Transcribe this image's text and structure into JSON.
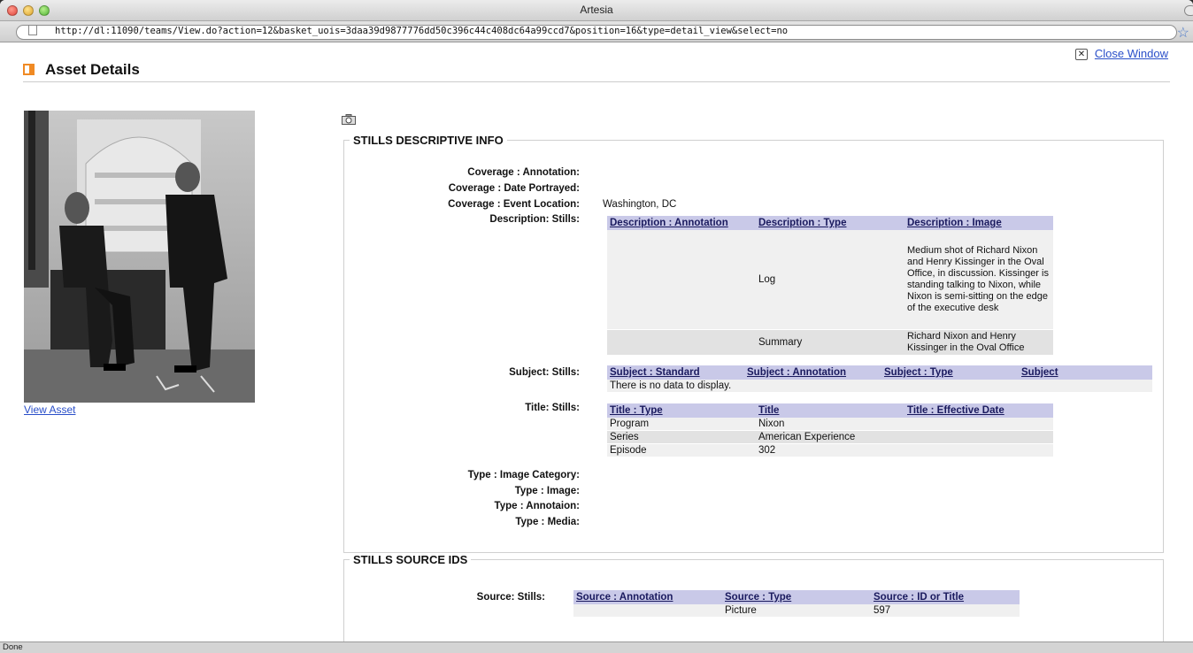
{
  "browser": {
    "window_title": "Artesia",
    "url": "http://dl:11090/teams/View.do?action=12&basket_uois=3daa39d9877776dd50c396c44c408dc64a99ccd7&position=16&type=detail_view&select=no",
    "status": "Done"
  },
  "header": {
    "close_window": "Close Window",
    "page_title": "Asset Details"
  },
  "asset": {
    "view_asset": "View Asset"
  },
  "descriptive": {
    "section_title": "STILLS DESCRIPTIVE INFO",
    "labels": {
      "coverage_annotation": "Coverage : Annotation:",
      "coverage_date": "Coverage : Date Portrayed:",
      "coverage_location": "Coverage : Event Location:",
      "description_stills": "Description: Stills:",
      "subject_stills": "Subject: Stills:",
      "title_stills": "Title: Stills:",
      "type_image_category": "Type : Image Category:",
      "type_image": "Type : Image:",
      "type_annotation": "Type : Annotaion:",
      "type_media": "Type : Media:"
    },
    "coverage_location_value": "Washington, DC",
    "description_table": {
      "headers": [
        "Description : Annotation",
        "Description : Type",
        "Description : Image"
      ],
      "rows": [
        [
          "",
          "Log",
          "Medium shot of Richard Nixon and Henry Kissinger in the Oval Office, in discussion. Kissinger is standing talking to Nixon, while Nixon is semi-sitting on the edge of the executive desk"
        ],
        [
          "",
          "Summary",
          "Richard Nixon and Henry Kissinger in the Oval Office"
        ]
      ]
    },
    "subject_table": {
      "headers": [
        "Subject : Standard",
        "Subject : Annotation",
        "Subject : Type",
        "Subject"
      ],
      "empty_message": "There is no data to display."
    },
    "title_table": {
      "headers": [
        "Title : Type",
        "Title",
        "Title : Effective Date"
      ],
      "rows": [
        [
          "Program",
          "Nixon",
          ""
        ],
        [
          "Series",
          "American Experience",
          ""
        ],
        [
          "Episode",
          "302",
          ""
        ]
      ]
    }
  },
  "source": {
    "section_title": "STILLS SOURCE IDS",
    "label": "Source: Stills:",
    "table": {
      "headers": [
        "Source : Annotation",
        "Source : Type",
        "Source : ID or Title"
      ],
      "rows": [
        [
          "",
          "Picture",
          "597"
        ]
      ]
    }
  }
}
